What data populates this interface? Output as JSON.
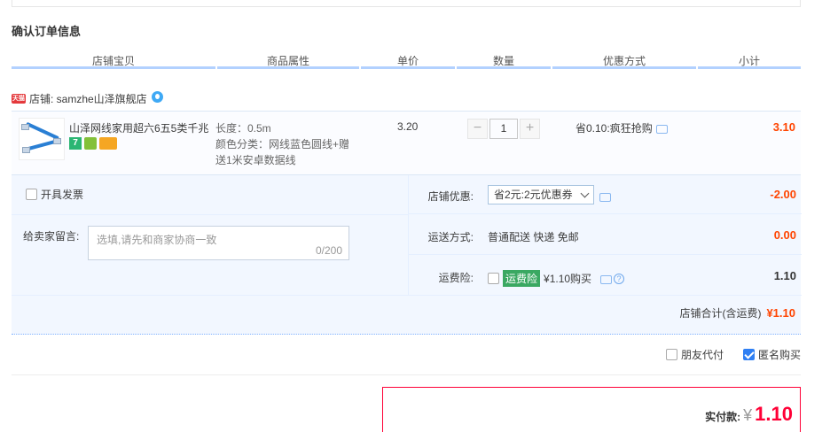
{
  "section_title": "确认订单信息",
  "columns": [
    "店铺宝贝",
    "商品属性",
    "单价",
    "数量",
    "优惠方式",
    "小计"
  ],
  "shop": {
    "tmall_badge": "天猫",
    "label": "店铺: samzhe山泽旗舰店"
  },
  "item": {
    "title": "山泽网线家用超六6五5类千兆",
    "badges": [
      "7",
      "",
      ""
    ],
    "attr_length": "长度：0.5m",
    "attr_color": "颜色分类：网线蓝色圆线+赠送1米安卓数据线",
    "unit_price": "3.20",
    "quantity": "1",
    "minus": "−",
    "plus": "+",
    "promo": "省0.10:疯狂抢购",
    "subtotal": "3.10"
  },
  "invoice_label": "开具发票",
  "message": {
    "label": "给卖家留言:",
    "placeholder": "选填,请先和商家协商一致",
    "count": "0/200"
  },
  "discount": {
    "label": "店铺优惠:",
    "selected": "省2元:2元优惠券",
    "amount": "-2.00"
  },
  "shipping": {
    "label": "运送方式:",
    "value": "普通配送 快递 免邮",
    "amount": "0.00"
  },
  "insurance": {
    "label": "运费险:",
    "tag": "运费险",
    "value": "¥1.10购买",
    "amount": "1.10"
  },
  "shop_total": {
    "label": "店铺合计(含运费)",
    "amount": "¥1.10"
  },
  "extras": {
    "friend_pay": "朋友代付",
    "anonymous": "匿名购买"
  },
  "payment": {
    "label": "实付款:",
    "symbol": "¥",
    "amount": "1.10"
  },
  "colors": {
    "accent_blue": "#b2d1ff",
    "price_red": "#ff4400",
    "pay_red": "#ff0036",
    "panel_bg": "#f2f7ff"
  }
}
